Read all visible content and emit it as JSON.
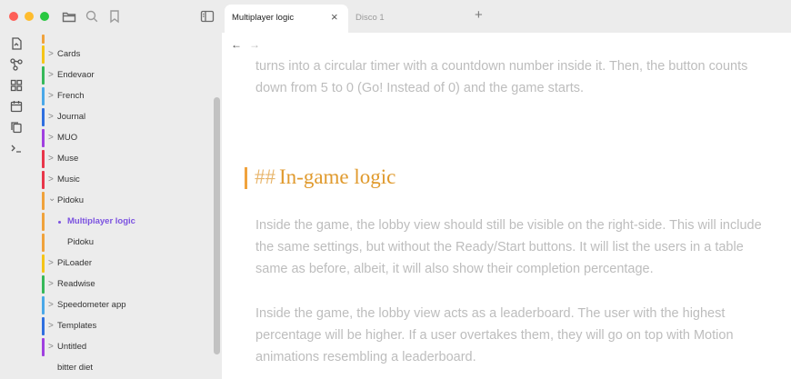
{
  "window": {
    "tabs": [
      {
        "label": "Multiplayer logic",
        "active": true
      },
      {
        "label": "Disco 1",
        "active": false
      }
    ],
    "close_glyph": "×",
    "new_tab_glyph": "+",
    "toolbar_icons": [
      "folder-icon",
      "search-icon",
      "bookmark-icon",
      "sidebar-toggle-icon"
    ]
  },
  "ribbon": {
    "icons": [
      "open-note-icon",
      "graph-icon",
      "canvas-icon",
      "calendar-icon",
      "copy-icon",
      "terminal-icon"
    ]
  },
  "sidebar": {
    "items": [
      {
        "label": "Cards",
        "chevron": ">",
        "color": "#f5c518"
      },
      {
        "label": "Endevaor",
        "chevron": ">",
        "color": "#36b85a"
      },
      {
        "label": "French",
        "chevron": ">",
        "color": "#4aa8e8"
      },
      {
        "label": "Journal",
        "chevron": ">",
        "color": "#2f6fe0"
      },
      {
        "label": "MUO",
        "chevron": ">",
        "color": "#a040e0"
      },
      {
        "label": "Muse",
        "chevron": ">",
        "color": "#e8364a"
      },
      {
        "label": "Music",
        "chevron": ">",
        "color": "#e8364a"
      },
      {
        "label": "Pidoku",
        "chevron": "⌄",
        "color": "#f0a23c"
      },
      {
        "label": "Multiplayer logic",
        "chevron": "",
        "color": "#f0a23c"
      },
      {
        "label": "Pidoku",
        "chevron": "",
        "color": "#f0a23c"
      },
      {
        "label": "PiLoader",
        "chevron": ">",
        "color": "#f5c518"
      },
      {
        "label": "Readwise",
        "chevron": ">",
        "color": "#36b85a"
      },
      {
        "label": "Speedometer app",
        "chevron": ">",
        "color": "#4aa8e8"
      },
      {
        "label": "Templates",
        "chevron": ">",
        "color": "#2f6fe0"
      },
      {
        "label": "Untitled",
        "chevron": ">",
        "color": "#a040e0"
      },
      {
        "label": "bitter diet",
        "chevron": "",
        "color": ""
      }
    ]
  },
  "editor": {
    "back_glyph": "←",
    "forward_glyph": "→",
    "intro_lines": [
      "turns into a circular timer with a countdown number inside it. Then, the button counts",
      "down from 5 to 0 (Go! Instead of 0) and the game starts."
    ],
    "heading_hash": "##",
    "heading_text": "In-game logic",
    "para1_lines": [
      "Inside the game, the lobby view should still be visible on the right-side. This will include",
      "the same settings, but without the Ready/Start buttons. It will list the users in a table",
      "same as before, albeit, it will also show their completion percentage."
    ],
    "para2_lines": [
      "Inside the game, the lobby view acts as a leaderboard. The user with the highest",
      "percentage will be higher. If a user overtakes them, they will go on top with Motion",
      "animations resembling a leaderboard."
    ],
    "accent_color": "#f0a23c",
    "link_color": "#7b52e0"
  }
}
